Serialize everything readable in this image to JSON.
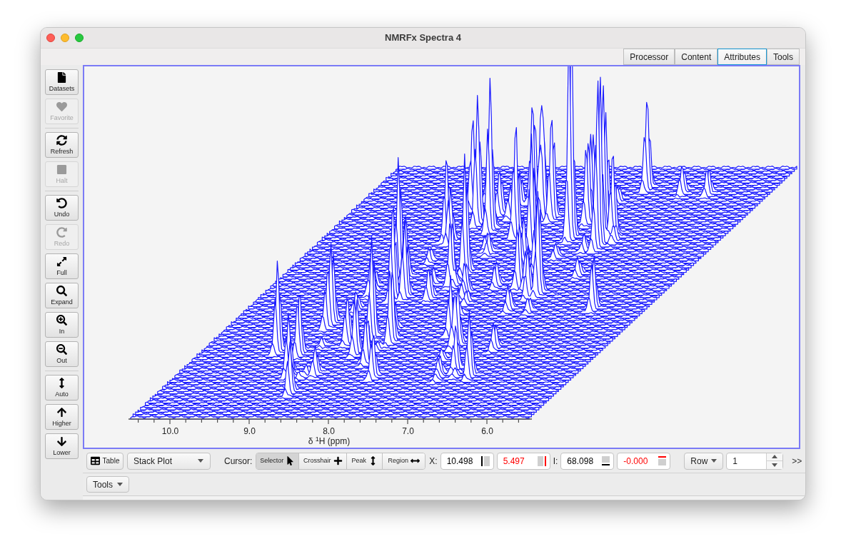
{
  "window": {
    "title": "NMRFx Spectra 4"
  },
  "tabs": [
    {
      "label": "Processor",
      "selected": false
    },
    {
      "label": "Content",
      "selected": false
    },
    {
      "label": "Attributes",
      "selected": true
    },
    {
      "label": "Tools",
      "selected": false
    }
  ],
  "toolbar": {
    "groups": [
      [
        {
          "label": "Datasets",
          "disabled": false
        },
        {
          "label": "Favorite",
          "disabled": true
        }
      ],
      [
        {
          "label": "Refresh",
          "disabled": false
        },
        {
          "label": "Halt",
          "disabled": true
        }
      ],
      [
        {
          "label": "Undo",
          "disabled": false
        },
        {
          "label": "Redo",
          "disabled": true
        },
        {
          "label": "Full",
          "disabled": false
        },
        {
          "label": "Expand",
          "disabled": false
        },
        {
          "label": "In",
          "disabled": false
        },
        {
          "label": "Out",
          "disabled": false
        }
      ],
      [
        {
          "label": "Auto",
          "disabled": false
        },
        {
          "label": "Higher",
          "disabled": false
        },
        {
          "label": "Lower",
          "disabled": false
        }
      ]
    ]
  },
  "plot": {
    "x_axis": {
      "ticks": [
        "10.0",
        "9.0",
        "8.0",
        "7.0",
        "6.0"
      ],
      "label": "δ $^{1}$H (ppm)"
    }
  },
  "bottom_bar": {
    "table_button": "Table",
    "display_mode": {
      "value": "Stack Plot"
    },
    "cursor": {
      "label": "Cursor:",
      "options": [
        {
          "label": "Selector",
          "selected": true
        },
        {
          "label": "Crosshair",
          "selected": false
        },
        {
          "label": "Peak",
          "selected": false
        },
        {
          "label": "Region",
          "selected": false
        }
      ]
    },
    "x": {
      "label": "X:",
      "fields": [
        {
          "value": "10.498",
          "color": "#000000"
        },
        {
          "value": "5.497",
          "color": "#ff0000"
        }
      ]
    },
    "intensity": {
      "label": "I:",
      "fields": [
        {
          "value": "68.098",
          "color": "#000000"
        },
        {
          "value": "-0.000",
          "color": "#ff0000"
        }
      ]
    },
    "row_mode": {
      "value": "Row"
    },
    "row_spinner": {
      "value": "1"
    },
    "overflow": ">>"
  },
  "tools_bar": {
    "menu": "Tools"
  }
}
